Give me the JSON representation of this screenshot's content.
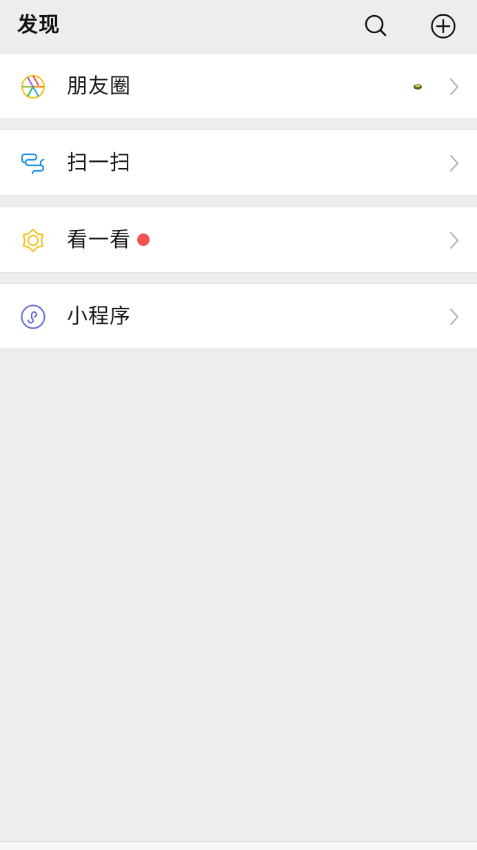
{
  "header": {
    "title": "发现",
    "search_icon": "search-icon",
    "add_icon": "plus-circle-icon"
  },
  "menu": {
    "items": [
      {
        "label": "朋友圈",
        "icon": "moments-aperture-icon",
        "has_thumbnail": true,
        "has_red_dot": false
      },
      {
        "label": "扫一扫",
        "icon": "scan-icon",
        "has_thumbnail": false,
        "has_red_dot": false
      },
      {
        "label": "看一看",
        "icon": "top-stories-icon",
        "has_thumbnail": false,
        "has_red_dot": true
      },
      {
        "label": "小程序",
        "icon": "mini-program-icon",
        "has_thumbnail": false,
        "has_red_dot": false
      }
    ]
  },
  "colors": {
    "background": "#ededed",
    "cell": "#ffffff",
    "scan_blue": "#1e90e6",
    "top_stories_yellow": "#f5c21a",
    "mini_program_purple": "#6b6fd6",
    "red_dot": "#f05350",
    "chevron": "#b3b3b3"
  }
}
